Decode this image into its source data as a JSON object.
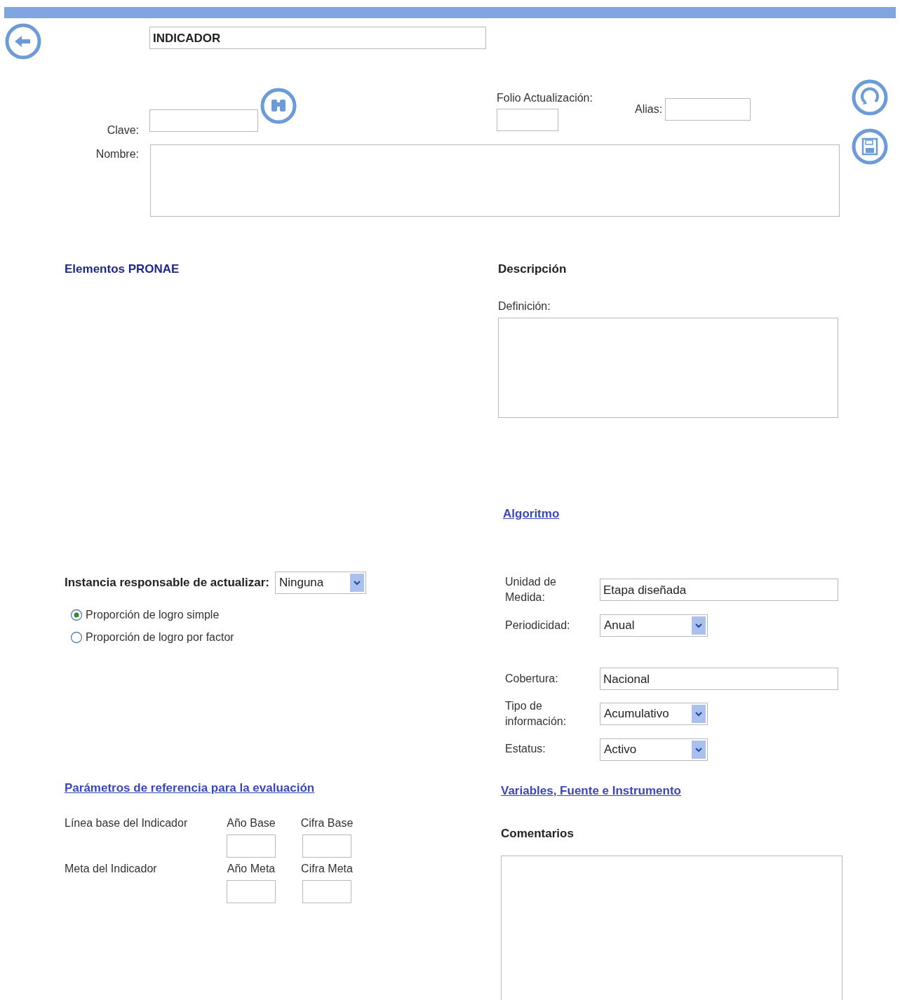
{
  "title_field": {
    "value": "INDICADOR"
  },
  "clave": {
    "label": "Clave:"
  },
  "folio": {
    "label": "Folio Actualización:"
  },
  "alias": {
    "label": "Alias:"
  },
  "nombre": {
    "label": "Nombre:"
  },
  "elementos": {
    "heading": "Elementos PRONAE"
  },
  "instancia": {
    "label": "Instancia responsable de actualizar:",
    "value": "Ninguna"
  },
  "radios": [
    {
      "label": "Proporción de logro simple",
      "selected": true
    },
    {
      "label": "Proporción de logro por factor",
      "selected": false
    }
  ],
  "parametros": {
    "link": "Parámetros de referencia para la evaluación",
    "rows": [
      {
        "label": "Línea base del Indicador",
        "columns": [
          "Año Base",
          "Cifra Base"
        ]
      },
      {
        "label": "Meta del Indicador",
        "columns": [
          "Año Meta",
          "Cifra Meta"
        ]
      }
    ]
  },
  "descripcion": {
    "heading": "Descripción",
    "definicion_label": "Definición:"
  },
  "algoritmo_link": "Algoritmo",
  "attribute_groups": [
    [
      {
        "kind": "text",
        "label": "Unidad de Medida:",
        "value": "Etapa diseñada"
      },
      {
        "kind": "select",
        "label": "Periodicidad:",
        "value": "Anual"
      }
    ],
    [
      {
        "kind": "text",
        "label": "Cobertura:",
        "value": "Nacional"
      },
      {
        "kind": "select",
        "label": "Tipo de información:",
        "value": "Acumulativo"
      },
      {
        "kind": "select",
        "label": "Estatus:",
        "value": "Activo"
      }
    ]
  ],
  "variables_link": "Variables, Fuente e Instrumento",
  "comentarios": {
    "heading": "Comentarios"
  }
}
